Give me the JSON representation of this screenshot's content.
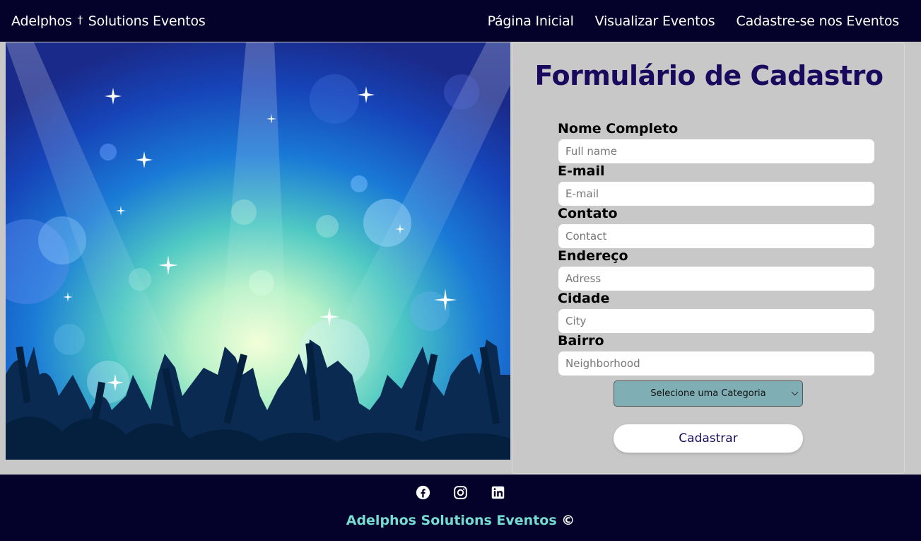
{
  "header": {
    "brand_left": "Adelphos",
    "brand_cross": "†",
    "brand_right": "Solutions Eventos",
    "nav": [
      {
        "label": "Página Inicial"
      },
      {
        "label": "Visualizar Eventos"
      },
      {
        "label": "Cadastre-se nos Eventos"
      }
    ]
  },
  "form": {
    "title": "Formulário de Cadastro",
    "fields": [
      {
        "label": "Nome Completo",
        "placeholder": "Full name",
        "value": ""
      },
      {
        "label": "E-mail",
        "placeholder": "E-mail",
        "value": ""
      },
      {
        "label": "Contato",
        "placeholder": "Contact",
        "value": ""
      },
      {
        "label": "Endereço",
        "placeholder": "Adress",
        "value": ""
      },
      {
        "label": "Cidade",
        "placeholder": "City",
        "value": ""
      },
      {
        "label": "Bairro",
        "placeholder": "Neighborhood",
        "value": ""
      }
    ],
    "category_selected": "Selecione uma Categoria",
    "submit_label": "Cadastrar"
  },
  "footer": {
    "socials": [
      {
        "icon": "facebook-icon"
      },
      {
        "icon": "instagram-icon"
      },
      {
        "icon": "linkedin-icon"
      }
    ],
    "brand": "Adelphos Solutions Eventos",
    "copyright_symbol": "©"
  },
  "colors": {
    "navbar_bg": "#04012a",
    "title": "#1a0a5e",
    "select_bg": "#7faeb4",
    "footer_brand": "#74dcd0"
  }
}
